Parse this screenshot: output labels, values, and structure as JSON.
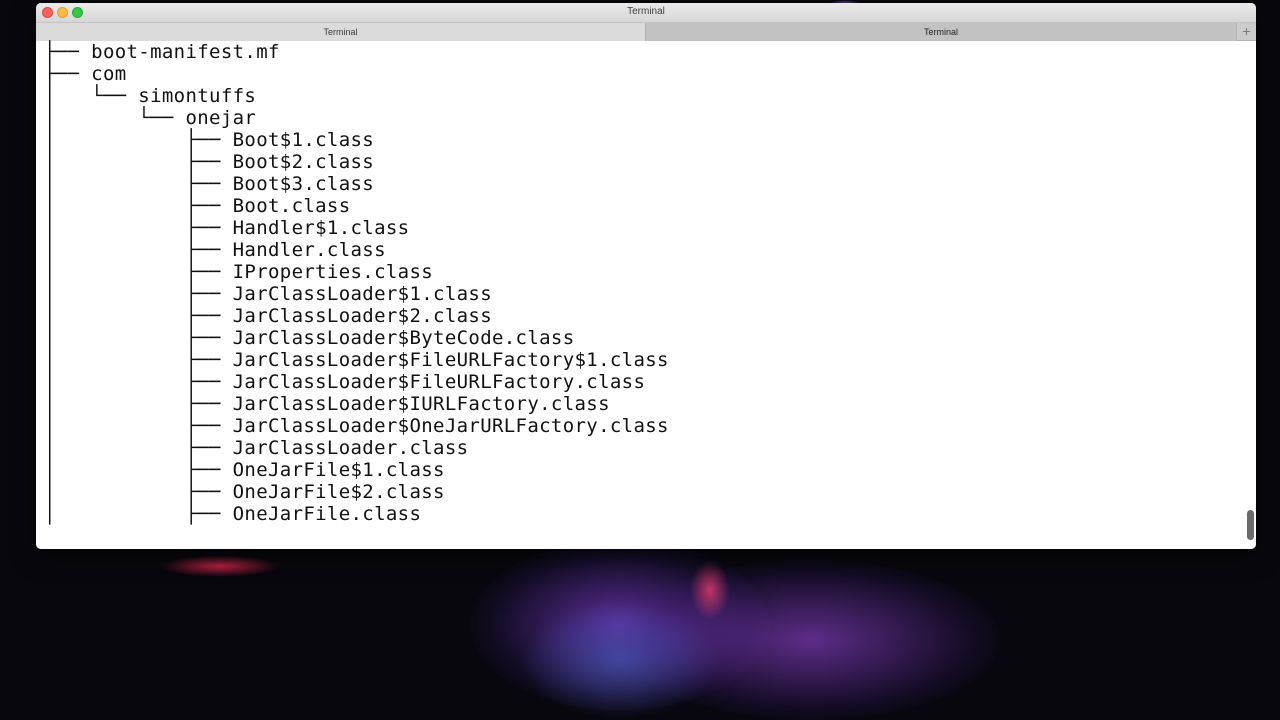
{
  "window": {
    "title": "Terminal",
    "tabs": [
      {
        "label": "Terminal",
        "active": false
      },
      {
        "label": "Terminal",
        "active": true
      }
    ],
    "new_tab_label": "+"
  },
  "terminal": {
    "lines": [
      "├── boot-manifest.mf",
      "├── com",
      "│   └── simontuffs",
      "│       └── onejar",
      "│           ├── Boot$1.class",
      "│           ├── Boot$2.class",
      "│           ├── Boot$3.class",
      "│           ├── Boot.class",
      "│           ├── Handler$1.class",
      "│           ├── Handler.class",
      "│           ├── IProperties.class",
      "│           ├── JarClassLoader$1.class",
      "│           ├── JarClassLoader$2.class",
      "│           ├── JarClassLoader$ByteCode.class",
      "│           ├── JarClassLoader$FileURLFactory$1.class",
      "│           ├── JarClassLoader$FileURLFactory.class",
      "│           ├── JarClassLoader$IURLFactory.class",
      "│           ├── JarClassLoader$OneJarURLFactory.class",
      "│           ├── JarClassLoader.class",
      "│           ├── OneJarFile$1.class",
      "│           ├── OneJarFile$2.class",
      "│           ├── OneJarFile.class"
    ]
  },
  "colors": {
    "terminal_bg": "#ffffff",
    "terminal_fg": "#111111",
    "close": "#fc605b",
    "minimize": "#fdbc40",
    "maximize": "#34c84a"
  },
  "icons": [
    "close-button-icon",
    "minimize-button-icon",
    "zoom-button-icon",
    "plus-icon"
  ]
}
